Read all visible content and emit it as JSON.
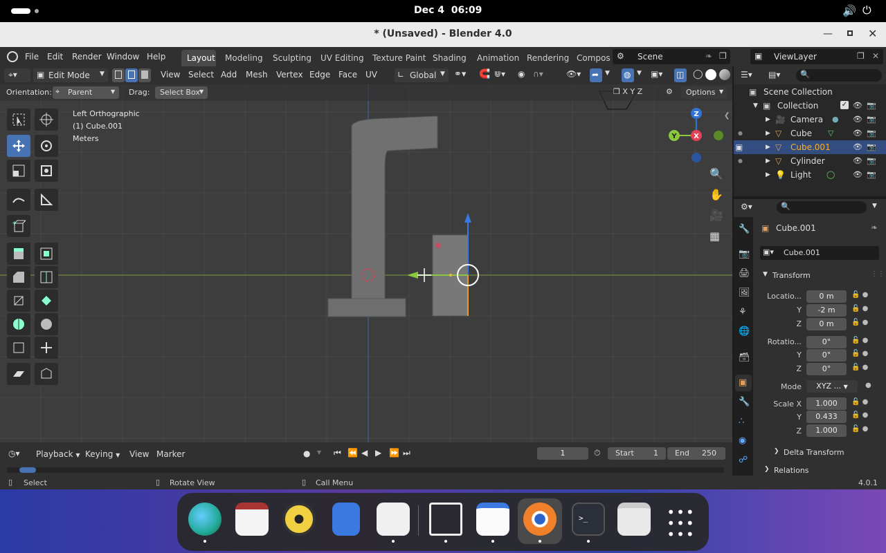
{
  "system_bar": {
    "date": "Dec 4",
    "time": "06:09"
  },
  "window": {
    "title": "* (Unsaved) - Blender 4.0"
  },
  "menu": {
    "items": [
      "File",
      "Edit",
      "Render",
      "Window",
      "Help"
    ]
  },
  "workspaces": {
    "tabs": [
      "Layout",
      "Modeling",
      "Sculpting",
      "UV Editing",
      "Texture Paint",
      "Shading",
      "Animation",
      "Rendering",
      "Compos"
    ],
    "active": "Layout"
  },
  "scene": {
    "name": "Scene",
    "view_layer": "ViewLayer"
  },
  "viewport_header": {
    "mode": "Edit Mode",
    "items": [
      "View",
      "Select",
      "Add",
      "Mesh",
      "Vertex",
      "Edge",
      "Face",
      "UV"
    ],
    "transform_orientation": "Global"
  },
  "tool_settings": {
    "orientation_label": "Orientation:",
    "orientation_value": "Parent",
    "drag_label": "Drag:",
    "drag_value": "Select Box",
    "options": "Options"
  },
  "viewport_info": {
    "view": "Left Orthographic",
    "object": "(1) Cube.001",
    "units": "Meters"
  },
  "gizmo": {
    "x": "X",
    "y": "Y",
    "z": "Z"
  },
  "outliner": {
    "root": "Scene Collection",
    "collection": "Collection",
    "items": [
      {
        "name": "Camera",
        "selected": false
      },
      {
        "name": "Cube",
        "selected": false
      },
      {
        "name": "Cube.001",
        "selected": true
      },
      {
        "name": "Cylinder",
        "selected": false
      },
      {
        "name": "Light",
        "selected": false
      }
    ]
  },
  "properties": {
    "object_name": "Cube.001",
    "data_name": "Cube.001",
    "panel": "Transform",
    "location_label": "Locatio...",
    "location": [
      "0 m",
      "-2 m",
      "0 m"
    ],
    "rotation_label": "Rotatio...",
    "rotation": [
      "0°",
      "0°",
      "0°"
    ],
    "mode_label": "Mode",
    "mode_value": "XYZ ...",
    "scale_label": "Scale X",
    "scale": [
      "1.000",
      "0.433",
      "1.000"
    ],
    "axis_y": "Y",
    "axis_z": "Z",
    "delta": "Delta Transform",
    "relations": "Relations"
  },
  "timeline": {
    "items": [
      "Playback",
      "Keying",
      "View",
      "Marker"
    ],
    "frame": "1",
    "start_label": "Start",
    "start": "1",
    "end_label": "End",
    "end": "250"
  },
  "status": {
    "select": "Select",
    "rotate": "Rotate View",
    "call_menu": "Call Menu",
    "version": "4.0.1"
  },
  "colors": {
    "accent": "#4772b3",
    "selected_text": "#ffaf29",
    "x_axis": "#e64158",
    "y_axis": "#8cc83c",
    "z_axis": "#2f73d6"
  }
}
